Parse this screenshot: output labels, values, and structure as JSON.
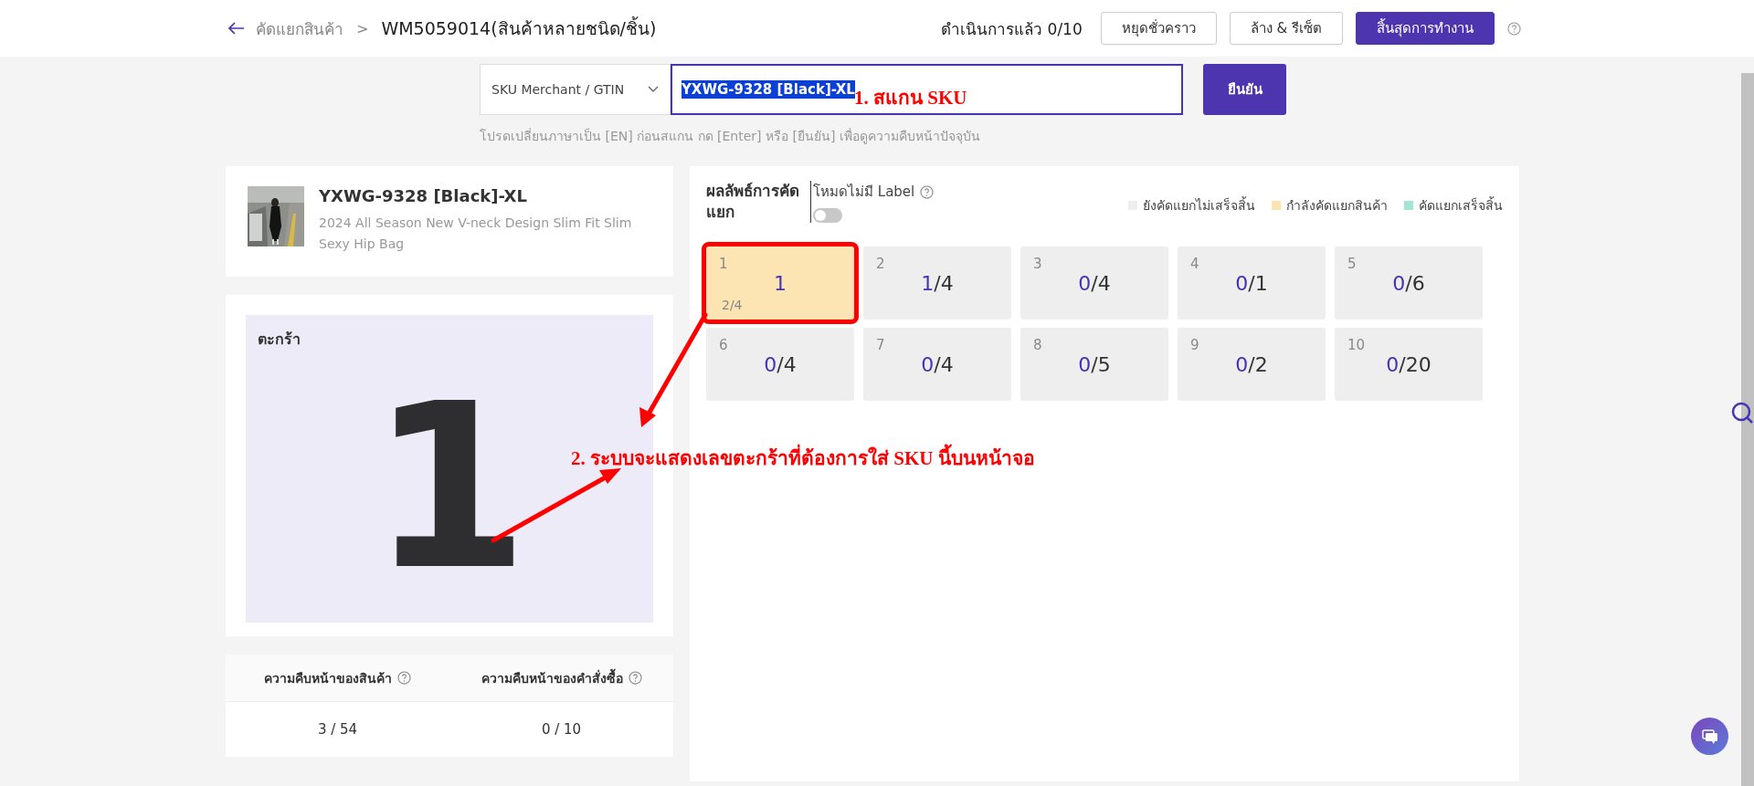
{
  "header": {
    "back_label": "คัดแยกสินค้า",
    "separator": ">",
    "title": "WM5059014(สินค้าหลายชนิด/ชิ้น)",
    "progress": "ดำเนินการแล้ว 0/10",
    "buttons": [
      {
        "label": "หยุดชั่วคราว",
        "kind": "outline"
      },
      {
        "label": "ล้าง & รีเซ็ต",
        "kind": "outline"
      },
      {
        "label": "สิ้นสุดการทำงาน",
        "kind": "primary"
      }
    ]
  },
  "scan": {
    "mode": "SKU Merchant / GTIN",
    "value": "YXWG-9328 [Black]-XL",
    "confirm": "ยืนยัน",
    "hint": "โปรดเปลี่ยนภาษาเป็น [EN] ก่อนสแกน กด [Enter] หรือ [ยืนยัน] เพื่อดูความคืบหน้าปัจจุบัน"
  },
  "product": {
    "sku": "YXWG-9328 [Black]-XL",
    "name": "2024 All Season New V-neck Design Slim Fit Slim Sexy Hip Bag"
  },
  "basket": {
    "label": "ตะกร้า",
    "number": "1"
  },
  "progress_table": {
    "columns": [
      "ความคืบหน้าของสินค้า",
      "ความคืบหน้าของคำสั่งซื้อ"
    ],
    "values": [
      "3 / 54",
      "0 / 10"
    ]
  },
  "results": {
    "title": "ผลลัพธ์การคัดแยก",
    "label_mode": {
      "label": "โหมดไม่มี Label",
      "on": false
    },
    "legend": [
      {
        "label": "ยังคัดแยกไม่เสร็จสิ้น",
        "color": "#eeeeee"
      },
      {
        "label": "กำลังคัดแยกสินค้า",
        "color": "#fde5b3"
      },
      {
        "label": "คัดแยกเสร็จสิ้น",
        "color": "#a5e3d5"
      }
    ],
    "baskets": [
      {
        "kind": "current",
        "number": "1",
        "main": "1",
        "sub": "2/4",
        "color": "#fde5b3",
        "highlighted": true
      },
      {
        "kind": "count",
        "number": "2",
        "done": "1",
        "rest": "/4",
        "color": "#eeeeee",
        "highlighted": false
      },
      {
        "kind": "count",
        "number": "3",
        "done": "0",
        "rest": "/4",
        "color": "#eeeeee",
        "highlighted": false
      },
      {
        "kind": "count",
        "number": "4",
        "done": "0",
        "rest": "/1",
        "color": "#eeeeee",
        "highlighted": false
      },
      {
        "kind": "count",
        "number": "5",
        "done": "0",
        "rest": "/6",
        "color": "#eeeeee",
        "highlighted": false
      },
      {
        "kind": "count",
        "number": "6",
        "done": "0",
        "rest": "/4",
        "color": "#eeeeee",
        "highlighted": false
      },
      {
        "kind": "count",
        "number": "7",
        "done": "0",
        "rest": "/4",
        "color": "#eeeeee",
        "highlighted": false
      },
      {
        "kind": "count",
        "number": "8",
        "done": "0",
        "rest": "/5",
        "color": "#eeeeee",
        "highlighted": false
      },
      {
        "kind": "count",
        "number": "9",
        "done": "0",
        "rest": "/2",
        "color": "#eeeeee",
        "highlighted": false
      },
      {
        "kind": "count",
        "number": "10",
        "done": "0",
        "rest": "/20",
        "color": "#eeeeee",
        "highlighted": false
      }
    ]
  },
  "annotations": [
    {
      "kind": "scan-note",
      "text": "1. สแกน SKU"
    },
    {
      "kind": "basket-note",
      "text": "2. ระบบจะแสดงเลขตะกร้าที่ต้องการใส่ SKU นี้บนหน้าจอ"
    }
  ]
}
